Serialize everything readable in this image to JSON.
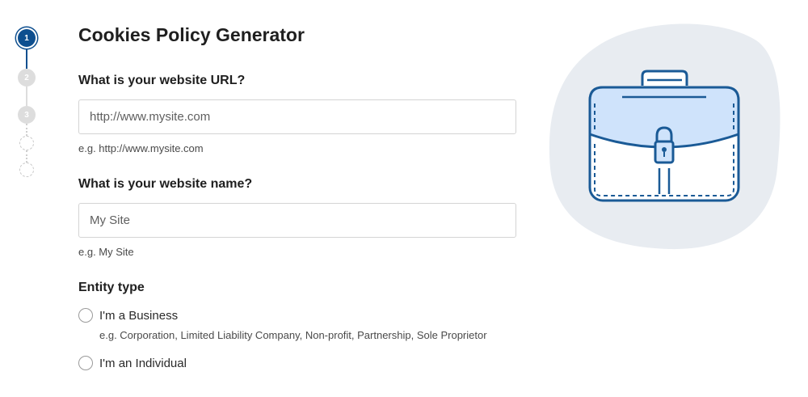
{
  "stepper": {
    "steps": [
      {
        "number": "1",
        "state": "active"
      },
      {
        "number": "2",
        "state": "upcoming"
      },
      {
        "number": "3",
        "state": "upcoming"
      },
      {
        "number": "",
        "state": "empty"
      },
      {
        "number": "",
        "state": "empty"
      }
    ],
    "colors": {
      "active": "#0e4f8f",
      "inactive": "#dddddd"
    }
  },
  "form": {
    "title": "Cookies Policy Generator",
    "url_question": {
      "label": "What is your website URL?",
      "placeholder": "http://www.mysite.com",
      "value": "",
      "hint": "e.g. http://www.mysite.com"
    },
    "name_question": {
      "label": "What is your website name?",
      "placeholder": "My Site",
      "value": "",
      "hint": "e.g. My Site"
    },
    "entity_type": {
      "label": "Entity type",
      "options": [
        {
          "label": "I'm a Business",
          "hint": "e.g. Corporation, Limited Liability Company, Non-profit, Partnership, Sole Proprietor",
          "selected": false
        },
        {
          "label": "I'm an Individual",
          "selected": false
        }
      ]
    }
  },
  "illustration": {
    "icon": "briefcase-icon",
    "colors": {
      "blob": "#e8ecf1",
      "stroke": "#1a5a96",
      "fill": "#cfe3fb"
    }
  }
}
